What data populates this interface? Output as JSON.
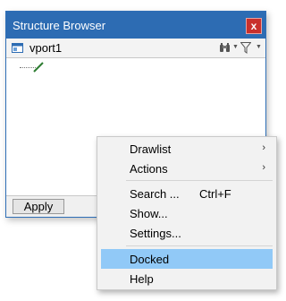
{
  "window": {
    "title": "Structure Browser",
    "close_label": "x",
    "viewport_name": "vport1",
    "apply_label": "Apply",
    "titlebar_color": "#2d6cb3",
    "icons": [
      "viewport-icon",
      "binoculars-icon",
      "filter-icon",
      "dropdown-arrow-icon",
      "tree-node-icon"
    ]
  },
  "menu": {
    "items": [
      {
        "label": "Drawlist",
        "shortcut": "",
        "submenu": true,
        "selected": false
      },
      {
        "label": "Actions",
        "shortcut": "",
        "submenu": true,
        "selected": false
      },
      {
        "label": "Search ...",
        "shortcut": "Ctrl+F",
        "submenu": false,
        "selected": false
      },
      {
        "label": "Show...",
        "shortcut": "",
        "submenu": false,
        "selected": false
      },
      {
        "label": "Settings...",
        "shortcut": "",
        "submenu": false,
        "selected": false
      },
      {
        "label": "Docked",
        "shortcut": "",
        "submenu": false,
        "selected": true
      },
      {
        "label": "Help",
        "shortcut": "",
        "submenu": false,
        "selected": false
      }
    ],
    "submenu_arrow": "›",
    "highlight_color": "#91c9f7"
  }
}
